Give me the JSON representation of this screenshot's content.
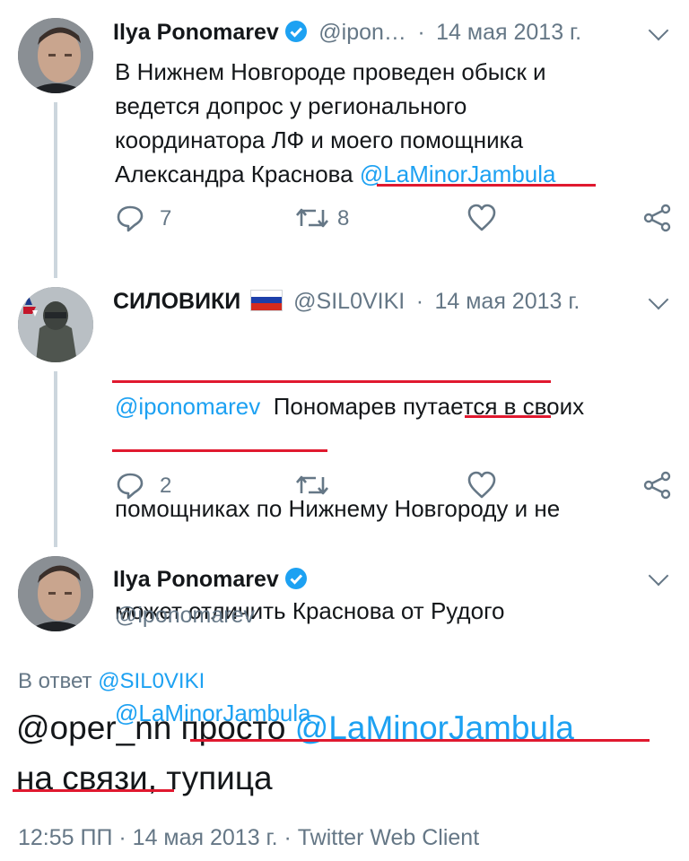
{
  "tweet1": {
    "name": "Ilya Ponomarev",
    "handle": "@ipon…",
    "sep": "·",
    "date": "14 мая 2013 г.",
    "lines": [
      "В Нижнем Новгороде проведен обыск и",
      "ведется допрос у регионального",
      "координатора ЛФ и моего помощника"
    ],
    "line4_text": "Александра Краснова ",
    "line4_mention": "@LaMinorJambula",
    "reply_count": "7",
    "retweet_count": "8"
  },
  "tweet2": {
    "name": "СИЛОВИКИ",
    "handle": "@SIL0VIKI",
    "sep": "·",
    "date": "14 мая 2013 г.",
    "mention1": "@iponomarev",
    "line1_text": "  Пономарев путается в своих",
    "line2_a": "помощниках по Нижнему Новгороду",
    "line2_b": " и не",
    "line3_a": "может отличить Краснова от ",
    "line3_b": "Рудого",
    "line4_mention": "@LaMinorJambula",
    "reply_count": "2"
  },
  "tweet3": {
    "name": "Ilya Ponomarev",
    "handle": "@iponomarev",
    "reply_to_label": "В ответ",
    "reply_to_handle": "@SIL0VIKI",
    "text_a": "@oper_nn ",
    "text_b": "просто ",
    "text_mention": "@LaMinorJambula",
    "text_c": "на связи",
    "text_d": ", тупица",
    "meta": "12:55 ПП · 14 мая 2013 г. · Twitter Web Client"
  },
  "colors": {
    "accent": "#1da1f2",
    "underline": "#e0192f",
    "muted": "#657786"
  }
}
